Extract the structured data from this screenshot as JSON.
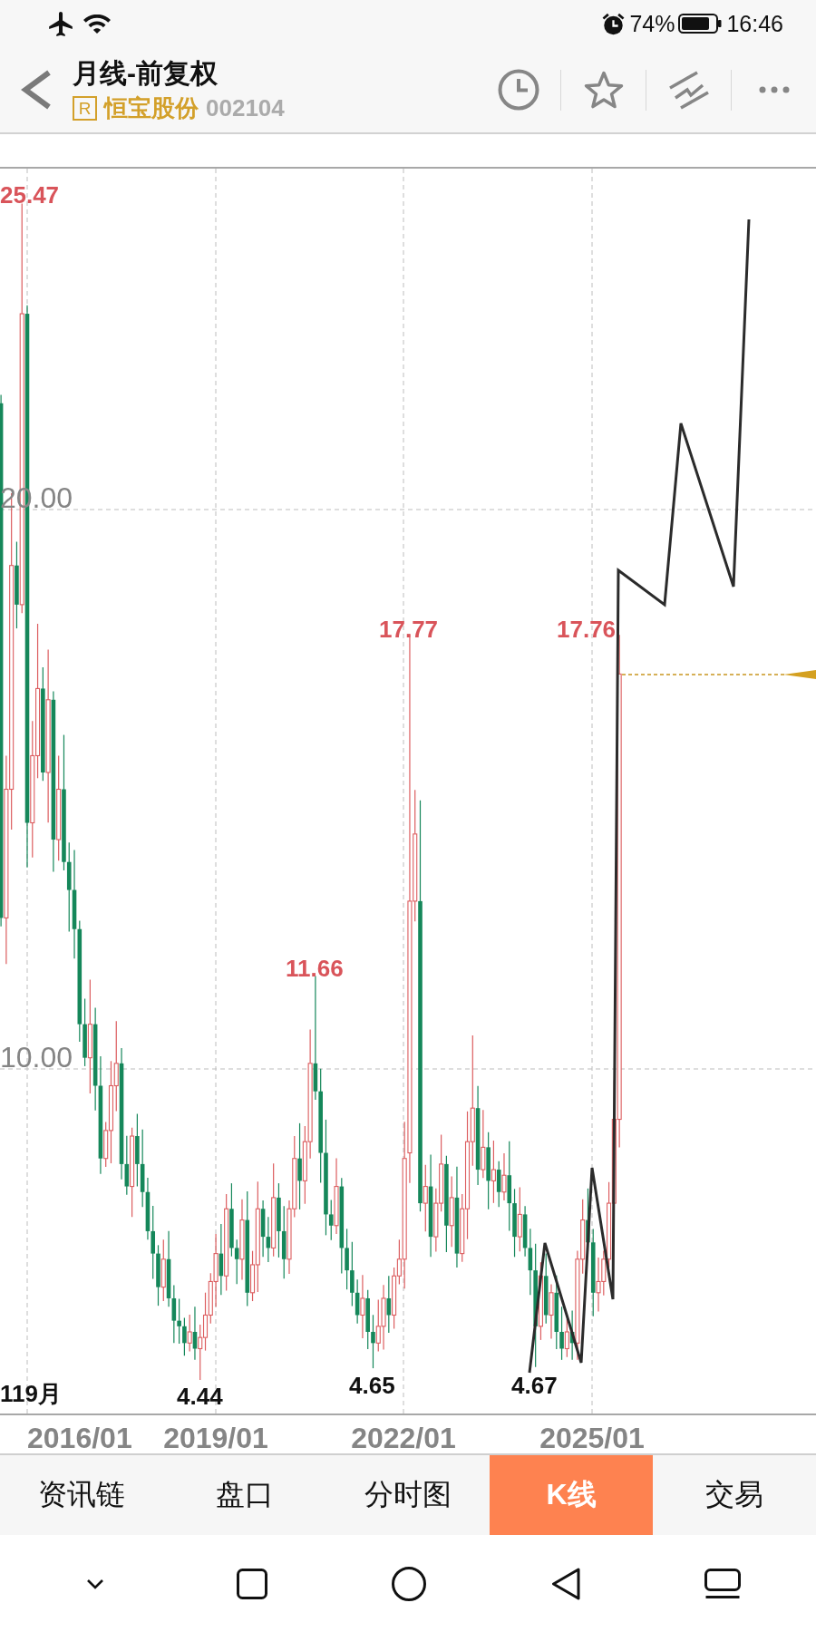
{
  "status_bar": {
    "battery": "74%",
    "time": "16:46"
  },
  "header": {
    "title": "月线-前复权",
    "badge": "R",
    "stock_name": "恒宝股份",
    "stock_code": "002104"
  },
  "chart": {
    "high_labels": [
      "25.47",
      "17.77",
      "17.76",
      "11.66"
    ],
    "y_axis_labels": [
      "20.00",
      "10.00"
    ],
    "edge_label": "119月",
    "low_labels": [
      "4.44",
      "4.65",
      "4.67"
    ],
    "x_axis_labels": [
      "2016/01",
      "2019/01",
      "2022/01",
      "2025/01"
    ]
  },
  "tabs": [
    {
      "label": "资讯链",
      "selected": false
    },
    {
      "label": "盘口",
      "selected": false
    },
    {
      "label": "分时图",
      "selected": false
    },
    {
      "label": "K线",
      "selected": true
    },
    {
      "label": "交易",
      "selected": false
    }
  ]
}
